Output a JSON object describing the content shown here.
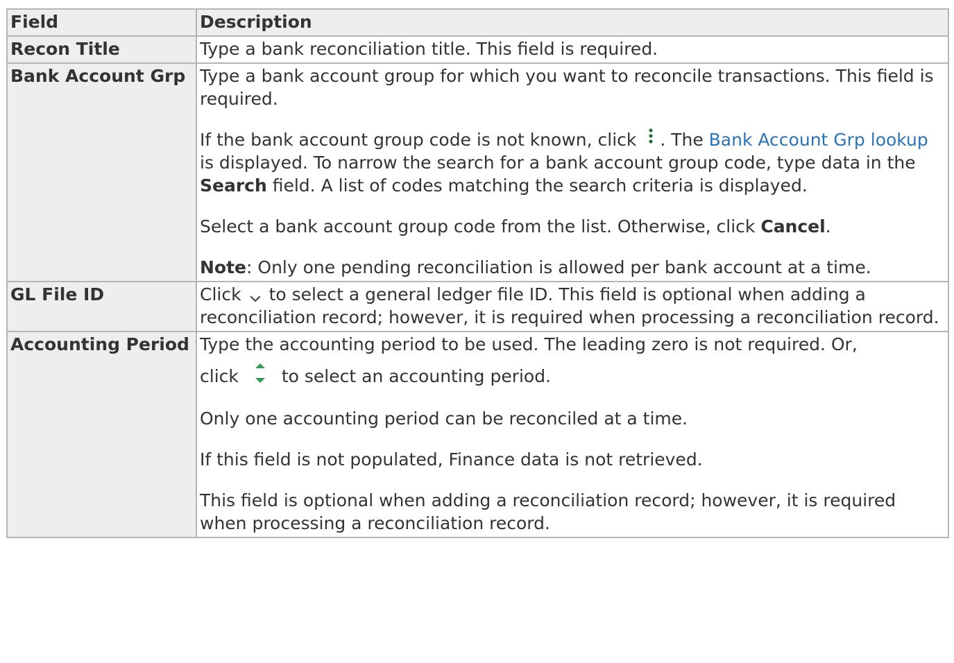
{
  "table": {
    "headers": {
      "field": "Field",
      "description": "Description"
    },
    "recon_title": {
      "field": "Recon Title",
      "desc": "Type a bank reconciliation title. This field is required."
    },
    "bank_account_grp": {
      "field": "Bank Account Grp",
      "p1": "Type a bank account group for which you want to reconcile transactions. This field is required.",
      "p2_a": "If the bank account group code is not known, click",
      "p2_b": ". The",
      "p2_link": "Bank Account Grp lookup",
      "p2_c": "is displayed. To narrow the search for a bank account group code, type data in the",
      "p2_bold": "Search",
      "p2_d": "field. A list of codes matching the search criteria is displayed.",
      "p3_a": "Select a bank account group code from the list. Otherwise, click",
      "p3_bold": "Cancel",
      "p3_b": ".",
      "p4_bold": "Note",
      "p4_a": ": Only one pending reconciliation is allowed per bank account at a time."
    },
    "gl_file_id": {
      "field": "GL File ID",
      "desc_a": "Click",
      "desc_b": "to select a general ledger file ID. This field is optional when adding a reconciliation record; however, it is required when processing a reconciliation record."
    },
    "accounting_period": {
      "field": "Accounting Period",
      "p1": "Type the accounting period to be used. The leading zero is not required. Or,",
      "p1b_a": "click",
      "p1b_b": "to select an accounting period.",
      "p2": "Only one accounting period can be reconciled at a time.",
      "p3": "If this field is not populated, Finance data is not retrieved.",
      "p4": "This field is optional when adding a reconciliation record; however, it is required when processing a reconciliation record."
    }
  },
  "icons": {
    "lookup": "vertical-dots-icon",
    "dropdown": "chevron-down-icon",
    "spinner": "spinner-up-down-icon"
  },
  "colors": {
    "link": "#2b73b7",
    "icon_green": "#2e9e4f",
    "icon_dots": "#2e6e3e",
    "header_bg": "#eeeeee",
    "border": "#b5b5b5"
  }
}
